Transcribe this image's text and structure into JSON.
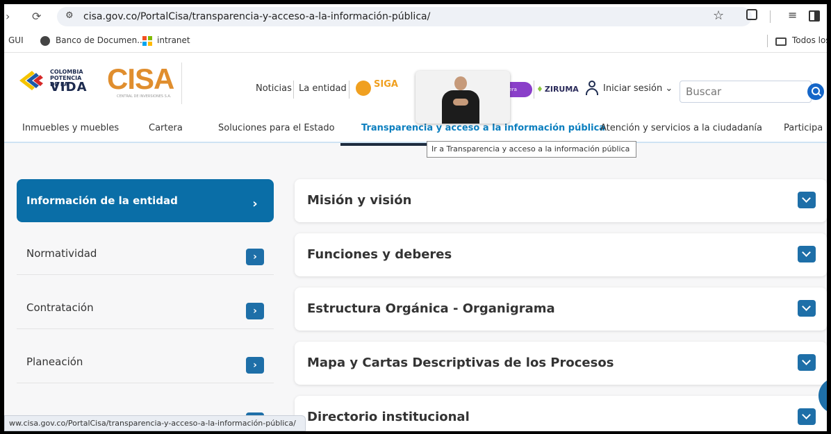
{
  "browser": {
    "url": "cisa.gov.co/PortalCisa/transparencia-y-acceso-a-la-información-pública/",
    "bookmarks": {
      "gui": "GUI",
      "banco": "Banco de Documen...",
      "intranet": "intranet",
      "todos": "Todos los"
    },
    "status_url": "ww.cisa.gov.co/PortalCisa/transparencia-y-acceso-a-la-información-pública/"
  },
  "header": {
    "colombia_small": "COLOMBIA POTENCIA DE LA",
    "colombia_big": "VIDA",
    "cisa": "CISA",
    "cisa_sub": "CENTRAL DE INVERSIONES S.A.",
    "nav": [
      "Noticias",
      "La entidad"
    ],
    "siga": "SIGA",
    "purple_pill": "nera",
    "ziruma": "ZIRUMA",
    "login": "Iniciar sesión ⌄",
    "search_placeholder": "Buscar"
  },
  "subnav": {
    "items": [
      "Inmuebles y muebles",
      "Cartera",
      "Soluciones para el Estado",
      "Transparencia y acceso a la información pública",
      "Atención y servicios a la ciudadanía",
      "Participa"
    ],
    "tooltip": "Ir a Transparencia y acceso a la información pública"
  },
  "sidebar": {
    "items": [
      {
        "label": "Información de la entidad",
        "arrow": "›"
      },
      {
        "label": "Normatividad",
        "arrow": "›"
      },
      {
        "label": "Contratación",
        "arrow": "›"
      },
      {
        "label": "Planeación",
        "arrow": "›"
      }
    ]
  },
  "accordion": {
    "items": [
      "Misión y visión",
      "Funciones y deberes",
      "Estructura Orgánica - Organigrama",
      "Mapa y Cartas Descriptivas de los Procesos",
      "Directorio institucional"
    ]
  },
  "colors": {
    "primary": "#0a6ea7",
    "accent_orange": "#e08e2e",
    "active_link": "#0c7fbf"
  }
}
